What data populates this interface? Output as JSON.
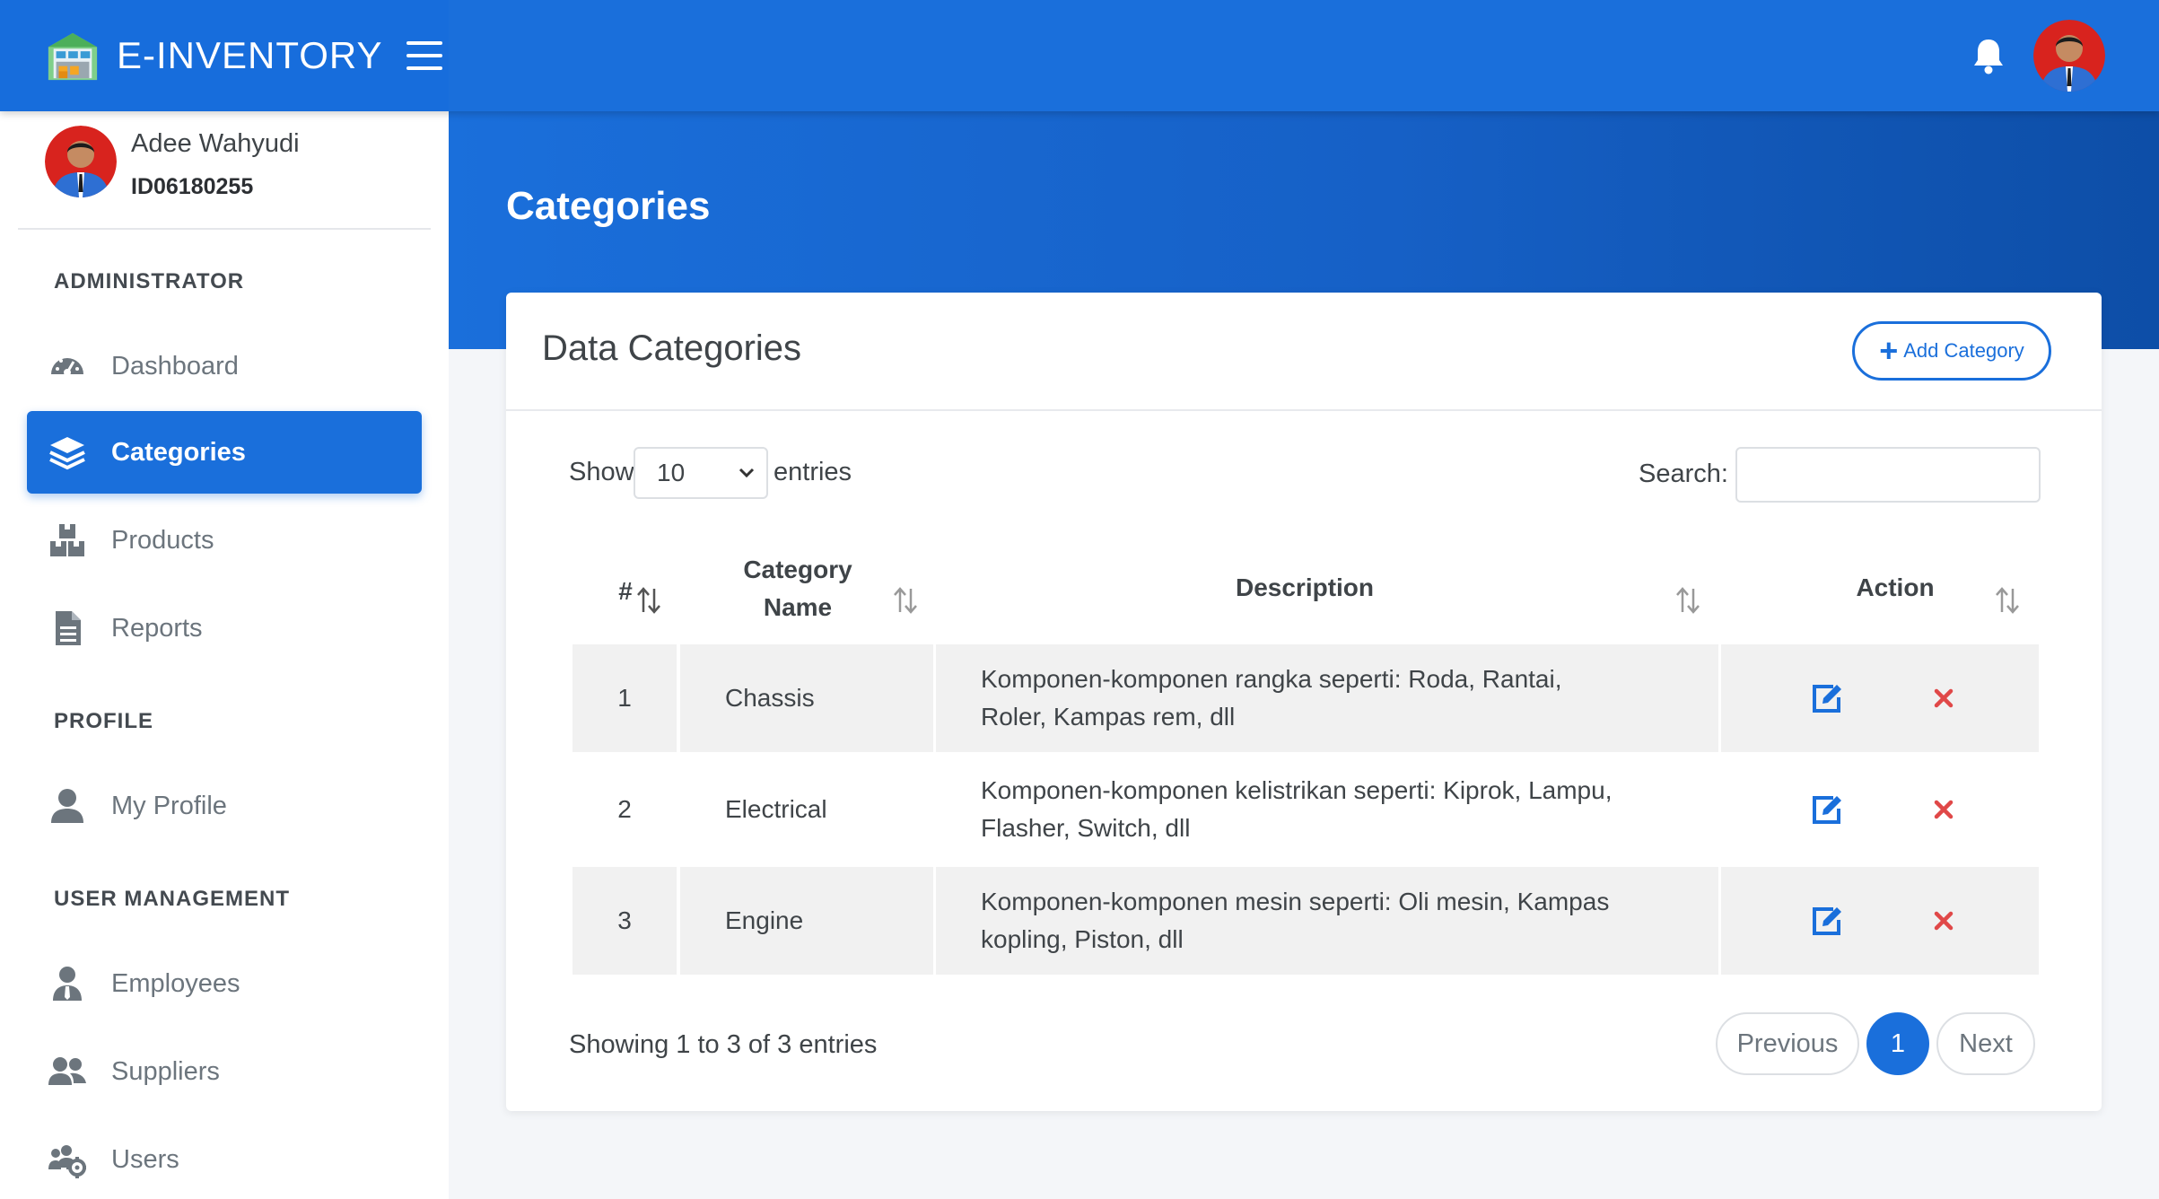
{
  "app": {
    "title": "E-INVENTORY"
  },
  "user": {
    "name": "Adee Wahyudi",
    "id": "ID06180255"
  },
  "sidebar": {
    "sections": [
      "ADMINISTRATOR",
      "PROFILE",
      "USER MANAGEMENT"
    ],
    "items": [
      {
        "label": "Dashboard",
        "icon": "dashboard-icon"
      },
      {
        "label": "Categories",
        "icon": "layers-icon",
        "active": true
      },
      {
        "label": "Products",
        "icon": "boxes-icon"
      },
      {
        "label": "Reports",
        "icon": "document-icon"
      },
      {
        "label": "My Profile",
        "icon": "user-icon"
      },
      {
        "label": "Employees",
        "icon": "employee-icon"
      },
      {
        "label": "Suppliers",
        "icon": "users-icon"
      },
      {
        "label": "Users",
        "icon": "users-cog-icon"
      }
    ]
  },
  "page": {
    "title": "Categories"
  },
  "card": {
    "title": "Data Categories",
    "add_label": "Add Category",
    "show_label": "Show",
    "entries_value": "10",
    "entries_label": "entries",
    "search_label": "Search:",
    "search_value": ""
  },
  "table": {
    "headers": [
      "#",
      "Category Name",
      "Description",
      "Action"
    ],
    "rows": [
      {
        "no": "1",
        "name": "Chassis",
        "description": "Komponen-komponen rangka seperti: Roda, Rantai, Roler, Kampas rem, dll"
      },
      {
        "no": "2",
        "name": "Electrical",
        "description": "Komponen-komponen kelistrikan seperti: Kiprok, Lampu, Flasher, Switch, dll"
      },
      {
        "no": "3",
        "name": "Engine",
        "description": "Komponen-komponen mesin seperti: Oli mesin, Kampas kopling, Piston, dll"
      }
    ]
  },
  "footer": {
    "showing": "Showing 1 to 3 of 3 entries",
    "previous": "Previous",
    "page": "1",
    "next": "Next"
  },
  "colors": {
    "primary": "#1a6fdb",
    "danger": "#e04848",
    "sidebar_text": "#6c757d"
  }
}
